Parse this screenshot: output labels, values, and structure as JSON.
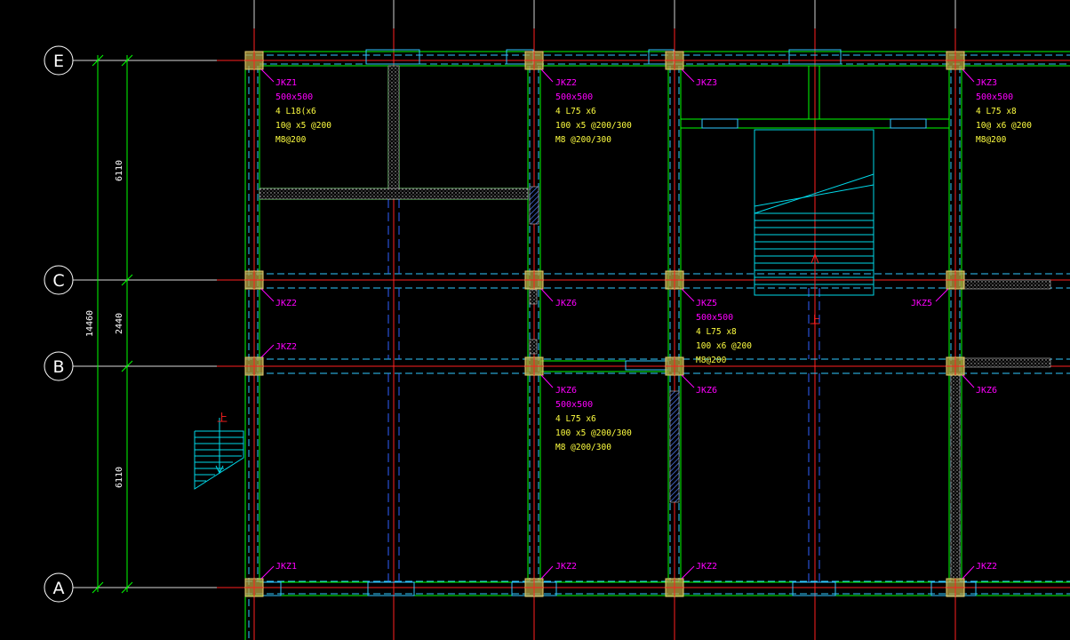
{
  "drawing": {
    "axes": [
      "E",
      "C",
      "B",
      "A"
    ],
    "dimensions": {
      "overall": "14460",
      "bay_e_c": "6110",
      "bay_c_b": "2440",
      "bay_b_a": "6110"
    },
    "colors": {
      "background": "#000000",
      "beam": "#00ff00",
      "hidden_beam": "#30c8ff",
      "center_line": "#ff2020",
      "dashed_blue": "#3060ff",
      "column": "#b8a040",
      "tag": "#ff00ff",
      "spec": "#ffff40",
      "stair": "#00d8e8",
      "hatch": "#c0c0c0"
    },
    "columns": {
      "jkz1_e": {
        "tag": "JKZ1",
        "size": "500x500",
        "bars": "4 L18(x6",
        "stirrup1": "10@ x5 @200",
        "stirrup2": "M8@200"
      },
      "jkz2_e": {
        "tag": "JKZ2",
        "size": "500x500",
        "bars": "4 L75 x6",
        "stirrup1": "100 x5 @200/300",
        "stirrup2": "M8 @200/300"
      },
      "jkz3_e2": {
        "tag": "JKZ3"
      },
      "jkz3_e": {
        "tag": "JKZ3",
        "size": "500x500",
        "bars": "4 L75 x8",
        "stirrup1": "10@ x6 @200",
        "stirrup2": "M8@200"
      },
      "jkz2_c": {
        "tag": "JKZ2"
      },
      "jkz6_c": {
        "tag": "JKZ6"
      },
      "jkz5_c": {
        "tag": "JKZ5",
        "size": "500x500",
        "bars": "4 L75 x8",
        "stirrup1": "100 x6 @200",
        "stirrup2": "M8@200"
      },
      "jkz5_c2": {
        "tag": "JKZ5"
      },
      "jkz2_b": {
        "tag": "JKZ2"
      },
      "jkz6_b": {
        "tag": "JKZ6",
        "size": "500x500",
        "bars": "4 L75 x6",
        "stirrup1": "100 x5 @200/300",
        "stirrup2": "M8 @200/300"
      },
      "jkz6_b2": {
        "tag": "JKZ6"
      },
      "jkz6_b3": {
        "tag": "JKZ6"
      },
      "jkz1_a": {
        "tag": "JKZ1"
      },
      "jkz2_a1": {
        "tag": "JKZ2"
      },
      "jkz2_a2": {
        "tag": "JKZ2"
      },
      "jkz2_a3": {
        "tag": "JKZ2"
      }
    },
    "stair_marks": [
      "上",
      "上"
    ]
  }
}
